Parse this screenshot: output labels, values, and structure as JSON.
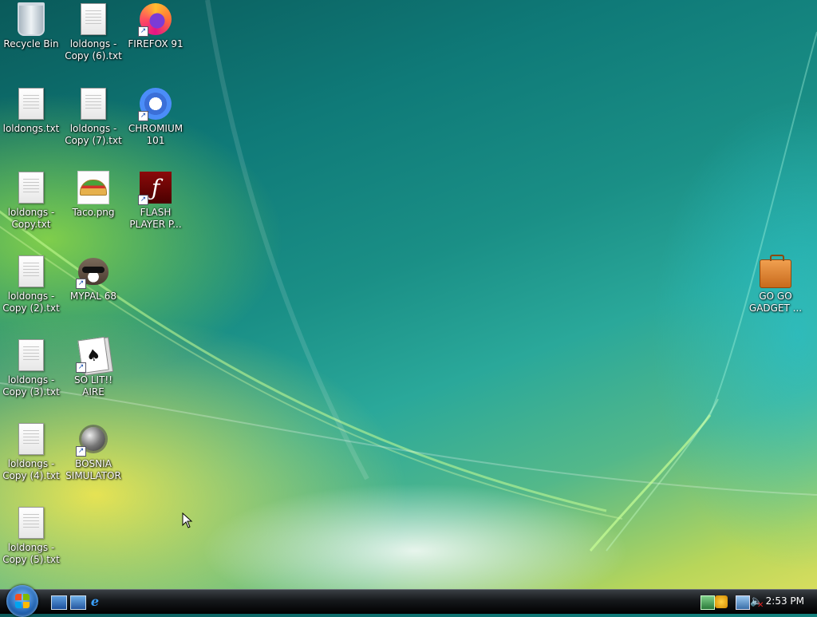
{
  "desktop": {
    "icons": [
      {
        "label": "Recycle Bin"
      },
      {
        "label": "loldongs -\nCopy (6).txt"
      },
      {
        "label": "FIREFOX 91"
      },
      {
        "label": "loldongs.txt"
      },
      {
        "label": "loldongs -\nCopy (7).txt"
      },
      {
        "label": "CHROMIUM\n101"
      },
      {
        "label": "loldongs -\nCopy.txt"
      },
      {
        "label": "Taco.png"
      },
      {
        "label": "FLASH\nPLAYER P..."
      },
      {
        "label": "loldongs -\nCopy (2).txt"
      },
      {
        "label": "MYPAL 68"
      },
      {
        "label": "loldongs -\nCopy (3).txt"
      },
      {
        "label": "SO LIT!! AIRE"
      },
      {
        "label": "loldongs -\nCopy (4).txt"
      },
      {
        "label": "BOSNIA\nSIMULATOR"
      },
      {
        "label": "loldongs -\nCopy (5).txt"
      },
      {
        "label": "GO GO\nGADGET ..."
      }
    ]
  },
  "taskbar": {
    "clock": "2:53 PM",
    "quick_launch": [
      "show-desktop-icon",
      "switch-windows-icon",
      "internet-explorer-icon"
    ],
    "tray_icons": [
      "network-icon",
      "security-icon",
      "display-icon",
      "volume-muted-icon"
    ]
  }
}
